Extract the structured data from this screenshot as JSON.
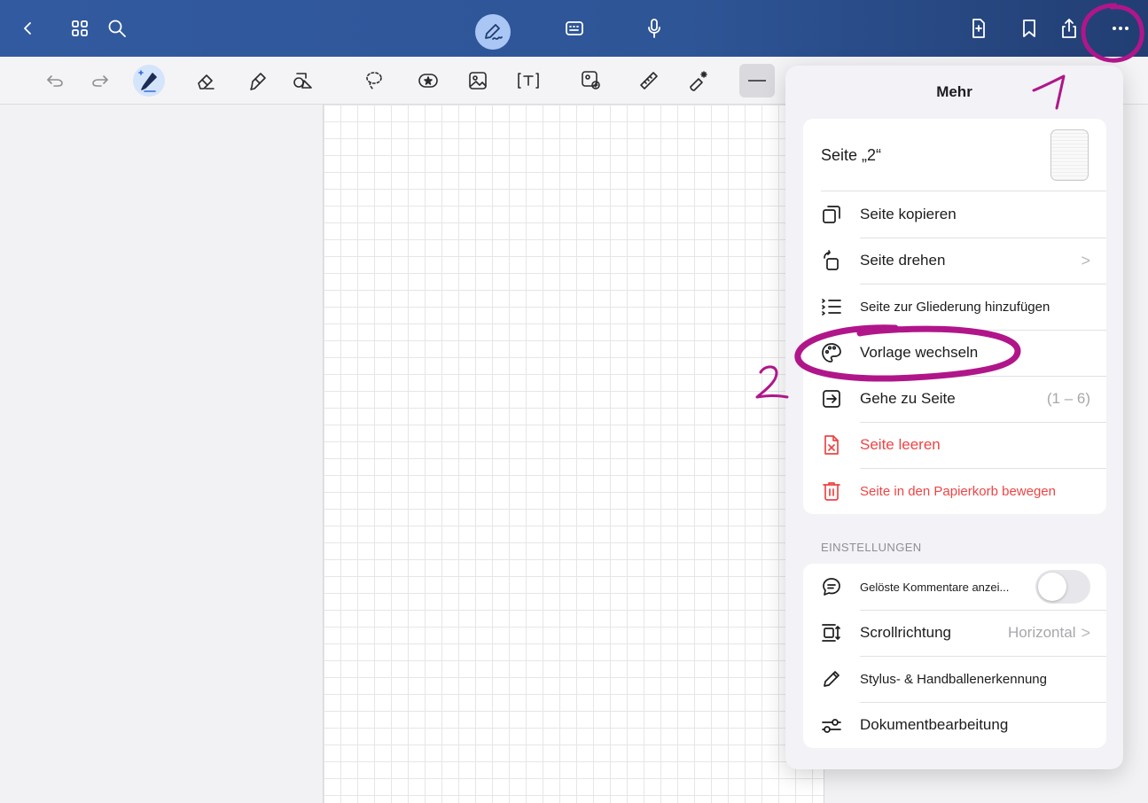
{
  "topbar": {
    "left_icons": [
      "chevron-left-icon",
      "grid-icon",
      "search-icon"
    ],
    "center_icons": [
      "handwriting-pen-icon",
      "keyboard-icon",
      "microphone-icon"
    ],
    "right_icons": [
      "add-page-icon",
      "bookmark-icon",
      "share-icon",
      "more-icon"
    ]
  },
  "toolbar": {
    "tools": [
      "undo-icon",
      "redo-icon",
      "pen-icon",
      "eraser-icon",
      "highlighter-icon",
      "shapes-icon",
      "lasso-icon",
      "sticker-icon",
      "image-icon",
      "text-box-icon",
      "camera-icon",
      "ruler-icon",
      "laser-pointer-icon"
    ],
    "active_tool": "pen-icon"
  },
  "popover": {
    "title": "Mehr",
    "page_name": "Seite „2“",
    "page_actions": [
      {
        "label": "Seite kopieren",
        "icon": "copy-icon"
      },
      {
        "label": "Seite drehen",
        "icon": "rotate-icon",
        "chevron": ">"
      },
      {
        "label": "Seite zur Gliederung hinzufügen",
        "icon": "outline-icon"
      },
      {
        "label": "Vorlage wechseln",
        "icon": "palette-icon"
      },
      {
        "label": "Gehe zu Seite",
        "icon": "go-to-page-icon",
        "value": "(1 – 6)"
      },
      {
        "label": "Seite leeren",
        "icon": "clear-page-icon"
      },
      {
        "label": "Seite in den Papierkorb bewegen",
        "icon": "trash-icon"
      }
    ],
    "settings_title": "EINSTELLUNGEN",
    "settings": [
      {
        "label": "Gelöste Kommentare anzei...",
        "icon": "comment-icon",
        "toggle": false
      },
      {
        "label": "Scrollrichtung",
        "icon": "scroll-direction-icon",
        "value": "Horizontal",
        "chevron": ">"
      },
      {
        "label": "Stylus- & Handballenerkennung",
        "icon": "stylus-icon"
      },
      {
        "label": "Dokumentbearbeitung",
        "icon": "document-settings-icon"
      }
    ]
  },
  "annotations": {
    "marker_1": "1",
    "marker_2": "2",
    "color": "#b0168a"
  },
  "colors": {
    "topbar": "#325aa0",
    "destructive": "#ee4444",
    "accent_pen": "#aac6f4"
  }
}
